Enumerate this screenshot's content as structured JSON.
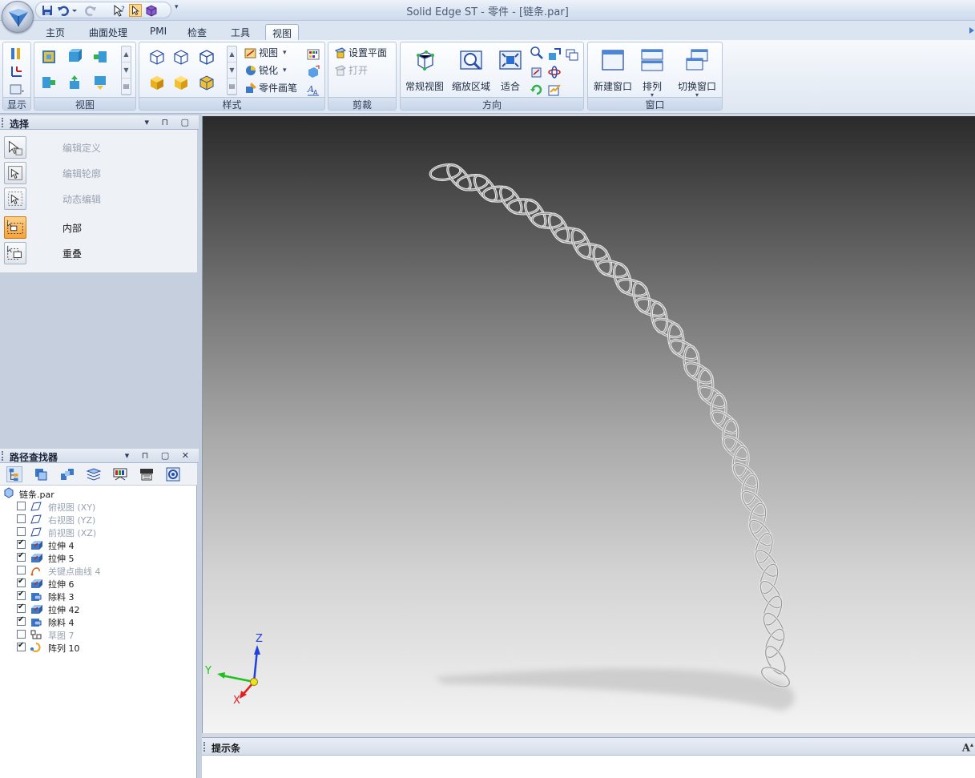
{
  "window": {
    "title": "Solid Edge ST - 零件 - [链条.par]"
  },
  "tabs": [
    "主页",
    "曲面处理",
    "PMI",
    "检查",
    "工具",
    "视图"
  ],
  "active_tab": "视图",
  "ribbon": {
    "groups": {
      "display": "显示",
      "views": "视图",
      "style": "样式",
      "clip": "剪裁",
      "orient": "方向",
      "window": "窗口"
    },
    "style_items": {
      "view": "视图",
      "sharpen": "锐化",
      "part_painter": "零件画笔"
    },
    "clip_items": {
      "set_plane": "设置平面",
      "open": "打开"
    },
    "orient_items": {
      "standard_view": "常规视图",
      "zoom_area": "缩放区域",
      "fit": "适合"
    },
    "window_items": {
      "new_window": "新建窗口",
      "arrange": "排列",
      "switch_window": "切换窗口"
    }
  },
  "select_panel": {
    "title": "选择",
    "items": [
      {
        "label": "编辑定义",
        "enabled": false,
        "active": false
      },
      {
        "label": "编辑轮廓",
        "enabled": false,
        "active": false
      },
      {
        "label": "动态编辑",
        "enabled": false,
        "active": false
      },
      {
        "label": "内部",
        "enabled": true,
        "active": true
      },
      {
        "label": "重叠",
        "enabled": true,
        "active": false
      }
    ]
  },
  "pathfinder": {
    "title": "路径查找器",
    "root": "链条.par",
    "items": [
      {
        "label": "俯视图 (XY)",
        "checked": false,
        "dim": true,
        "icon": "plane-icon"
      },
      {
        "label": "右视图 (YZ)",
        "checked": false,
        "dim": true,
        "icon": "plane-icon"
      },
      {
        "label": "前视图 (XZ)",
        "checked": false,
        "dim": true,
        "icon": "plane-icon"
      },
      {
        "label": "拉伸 4",
        "checked": true,
        "dim": false,
        "icon": "extrude-icon"
      },
      {
        "label": "拉伸 5",
        "checked": true,
        "dim": false,
        "icon": "extrude-icon"
      },
      {
        "label": "关键点曲线 4",
        "checked": false,
        "dim": true,
        "icon": "curve-icon"
      },
      {
        "label": "拉伸 6",
        "checked": true,
        "dim": false,
        "icon": "extrude-icon"
      },
      {
        "label": "除料 3",
        "checked": true,
        "dim": false,
        "icon": "cutout-icon"
      },
      {
        "label": "拉伸 42",
        "checked": true,
        "dim": false,
        "icon": "extrude-icon"
      },
      {
        "label": "除料 4",
        "checked": true,
        "dim": false,
        "icon": "cutout-icon"
      },
      {
        "label": "草图 7",
        "checked": false,
        "dim": true,
        "icon": "sketch-icon"
      },
      {
        "label": "阵列 10",
        "checked": true,
        "dim": false,
        "icon": "pattern-icon"
      }
    ]
  },
  "viewport": {
    "triad": {
      "x": "X",
      "y": "Y",
      "z": "Z"
    },
    "colors": {
      "x_axis": "#e02020",
      "y_axis": "#20c020",
      "z_axis": "#2040e0"
    }
  },
  "prompt_bar": {
    "title": "提示条",
    "font_button": "A"
  }
}
